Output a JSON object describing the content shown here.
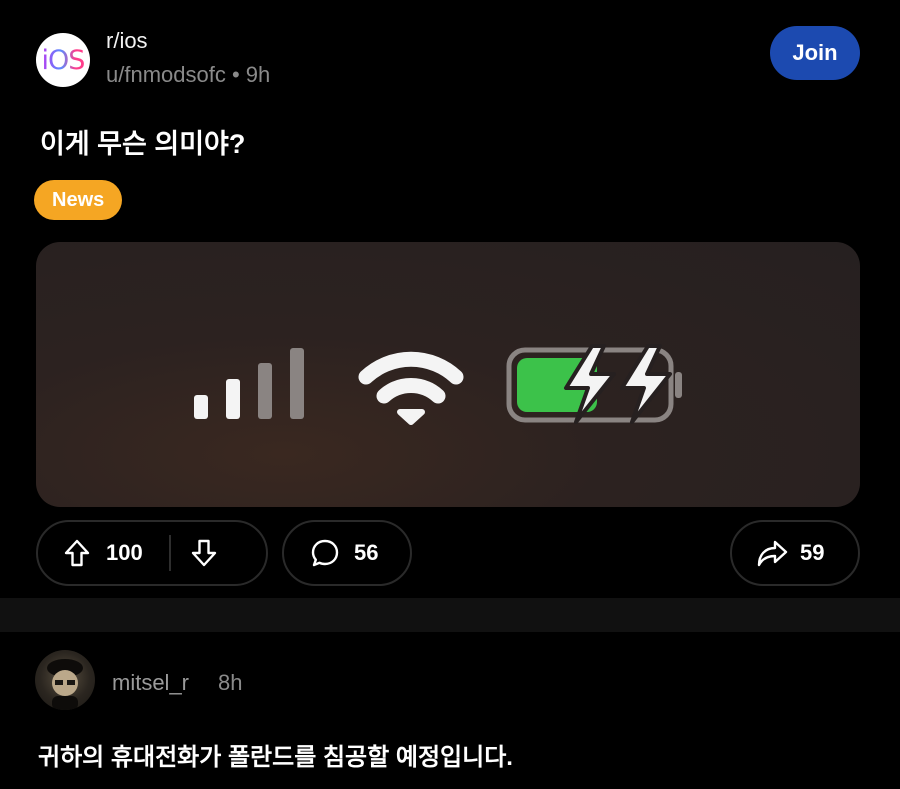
{
  "post": {
    "subreddit": "r/ios",
    "subreddit_icon_text": "iOS",
    "author": "u/fnmodsofc",
    "separator": "•",
    "age": "9h",
    "join_label": "Join",
    "title": "이게 무슨 의미야?",
    "flair": "News"
  },
  "actions": {
    "upvotes": "100",
    "comments": "56",
    "shares": "59"
  },
  "media": {
    "battery_fill": 0.55,
    "battery_color": "#3cc24a"
  },
  "comment": {
    "author": "mitsel_r",
    "age": "8h",
    "text": "귀하의 휴대전화가 폴란드를 침공할 예정입니다."
  },
  "colors": {
    "join": "#1c4ab0",
    "flair": "#f5a623"
  }
}
